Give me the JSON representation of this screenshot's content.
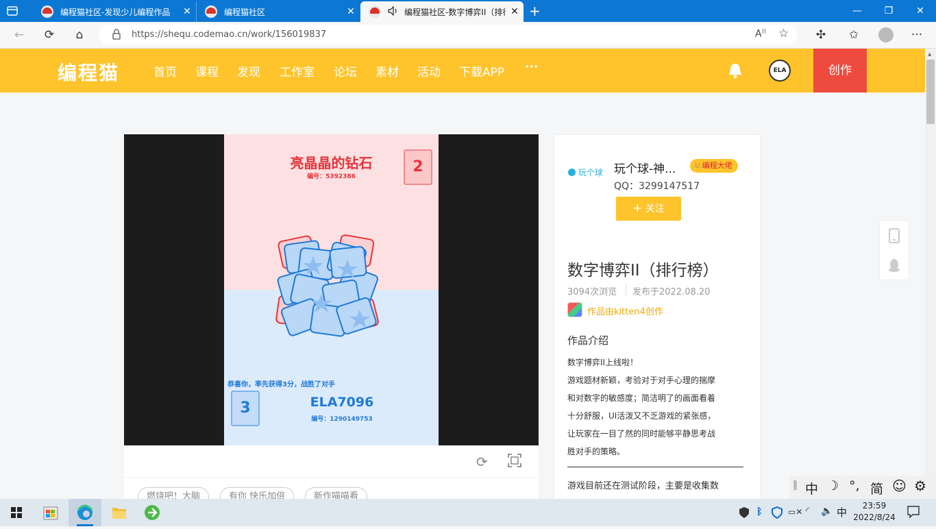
{
  "browser": {
    "tabs": [
      {
        "title": "编程猫社区-发现少儿编程作品"
      },
      {
        "title": "编程猫社区"
      },
      {
        "title": "编程猫社区-数字博弈II（排行"
      }
    ],
    "url": "https://shequ.codemao.cn/work/156019837"
  },
  "site": {
    "logo": "编程猫",
    "nav": [
      "首页",
      "课程",
      "发现",
      "工作室",
      "论坛",
      "素材",
      "活动",
      "下载APP"
    ],
    "more": "···",
    "avatar_text": "ELA",
    "create_label": "创作"
  },
  "game": {
    "player1_name": "亮晶晶的钻石",
    "player1_id": "编号：5392386",
    "player1_score": "2",
    "player2_name": "ELA7096",
    "player2_id": "编号：1290149753",
    "player2_score": "3",
    "message": "恭喜你，率先获得3分，战胜了对手",
    "colors": {
      "red": "#e8333a",
      "blue": "#1f7ad6"
    }
  },
  "tags": [
    "燃烧吧！大脑",
    "有你 快乐加倍",
    "新作喵喵看"
  ],
  "author": {
    "logo_text": "玩个球",
    "name": "玩个球-神...",
    "badge": "编程大佬",
    "qq": "QQ：3299147517",
    "follow_label": "关注"
  },
  "work": {
    "title": "数字博弈II（排行榜）",
    "views": "3094次浏览",
    "published": "发布于2022.08.20",
    "made_with": "作品由kitten4创作",
    "intro_heading": "作品介绍",
    "intro_lines": [
      "数字博弈II上线啦！",
      "游戏题材新颖，考验对于对手心理的揣摩",
      "和对数字的敏感度；简洁明了的画面看着",
      "十分舒服，UI活泼又不乏游戏的紧张感，",
      "让玩家在一目了然的同时能够平静思考战",
      "胜对手的策略。"
    ],
    "note": "游戏目前还在测试阶段，主要是收集数"
  },
  "ime": {
    "items": [
      "中",
      "☽",
      "°,",
      "简",
      "☺",
      "⚙"
    ]
  },
  "taskbar": {
    "lang": "中",
    "time": "23:59",
    "date": "2022/8/24"
  }
}
